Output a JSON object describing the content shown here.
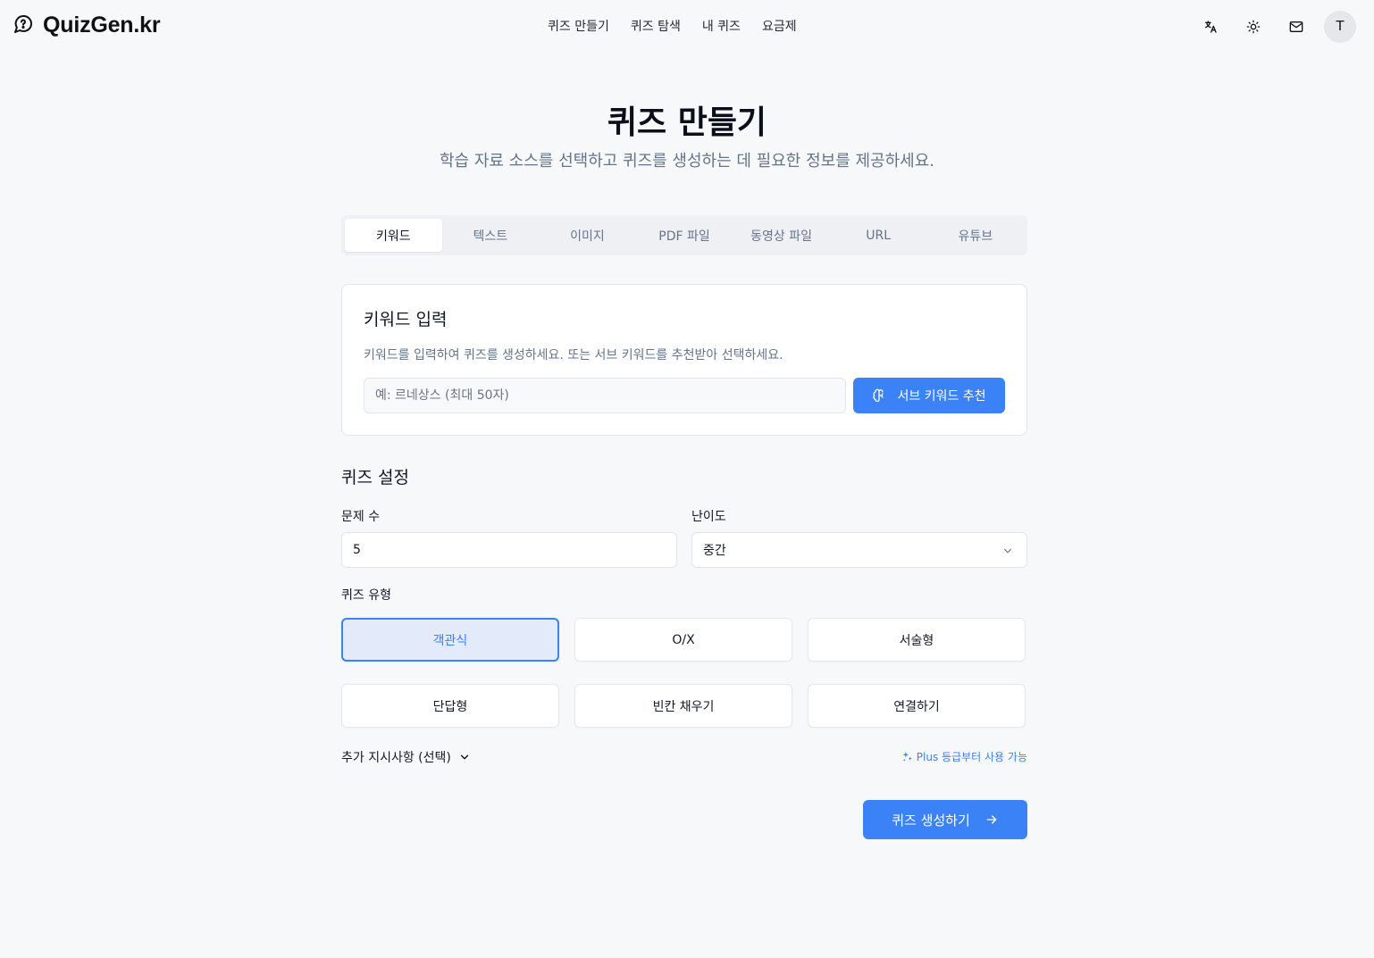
{
  "brand": {
    "name": "QuizGen.kr"
  },
  "nav": {
    "items": [
      "퀴즈 만들기",
      "퀴즈 탐색",
      "내 퀴즈",
      "요금제"
    ]
  },
  "header": {
    "avatar_initial": "T"
  },
  "page": {
    "title": "퀴즈 만들기",
    "subtitle": "학습 자료 소스를 선택하고 퀴즈를 생성하는 데 필요한 정보를 제공하세요."
  },
  "tabs": [
    "키워드",
    "텍스트",
    "이미지",
    "PDF 파일",
    "동영상 파일",
    "URL",
    "유튜브"
  ],
  "keyword_card": {
    "title": "키워드 입력",
    "description": "키워드를 입력하여 퀴즈를 생성하세요. 또는 서브 키워드를 추천받아 선택하세요.",
    "placeholder": "예: 르네상스 (최대 50자)",
    "value": "",
    "suggest_button": "서브 키워드 추천"
  },
  "settings": {
    "title": "퀴즈 설정",
    "count_label": "문제 수",
    "count_value": "5",
    "difficulty_label": "난이도",
    "difficulty_value": "중간",
    "type_label": "퀴즈 유형",
    "types": [
      "객관식",
      "O/X",
      "서술형",
      "단답형",
      "빈칸 채우기",
      "연결하기"
    ],
    "selected_type": "객관식",
    "extra_label": "추가 지시사항 (선택)",
    "plus_note": "Plus 등급부터 사용 가능"
  },
  "generate_button": "퀴즈 생성하기",
  "colors": {
    "accent": "#3b82f6",
    "selected_bg": "#e3ebfb",
    "muted": "#64748b"
  }
}
